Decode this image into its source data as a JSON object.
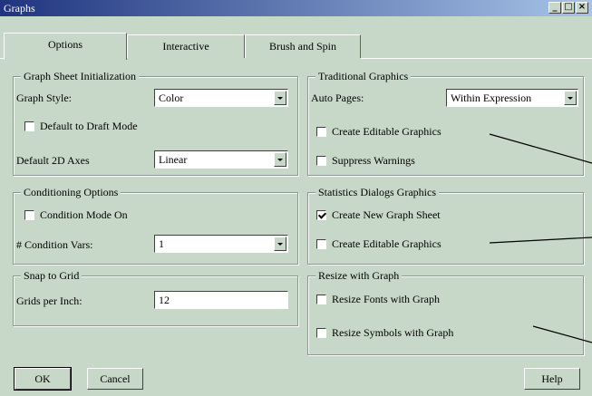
{
  "window": {
    "title": "Graphs"
  },
  "titlebar_buttons": {
    "minimize": "_",
    "maximize": "□",
    "close": "×"
  },
  "tabs": [
    {
      "label": "Options"
    },
    {
      "label": "Interactive"
    },
    {
      "label": "Brush and Spin"
    }
  ],
  "graph_sheet_init": {
    "title": "Graph Sheet Initialization",
    "graph_style_label": "Graph Style:",
    "graph_style_value": "Color",
    "draft_mode_label": "Default to Draft Mode",
    "draft_mode_checked": false,
    "default_axes_label": "Default 2D Axes",
    "default_axes_value": "Linear"
  },
  "conditioning": {
    "title": "Conditioning Options",
    "condition_mode_label": "Condition Mode On",
    "condition_mode_checked": false,
    "condition_vars_label": "# Condition Vars:",
    "condition_vars_value": "1"
  },
  "snap": {
    "title": "Snap to Grid",
    "grids_label": "Grids per Inch:",
    "grids_value": "12"
  },
  "traditional": {
    "title": "Traditional Graphics",
    "auto_pages_label": "Auto Pages:",
    "auto_pages_value": "Within Expression",
    "editable_label": "Create Editable Graphics",
    "editable_checked": false,
    "suppress_label": "Suppress Warnings",
    "suppress_checked": false
  },
  "statistics": {
    "title": "Statistics Dialogs Graphics",
    "new_sheet_label": "Create New Graph Sheet",
    "new_sheet_checked": true,
    "editable_label": "Create Editable Graphics",
    "editable_checked": false
  },
  "resize": {
    "title": "Resize with Graph",
    "fonts_label": "Resize Fonts with Graph",
    "fonts_checked": false,
    "symbols_label": "Resize Symbols with Graph",
    "symbols_checked": false
  },
  "buttons": {
    "ok": "OK",
    "cancel": "Cancel",
    "help": "Help"
  }
}
